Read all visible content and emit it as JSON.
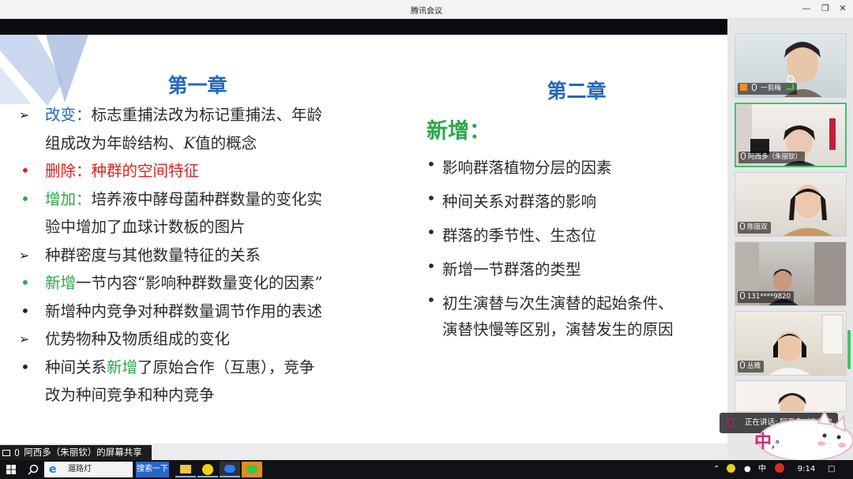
{
  "window": {
    "title": "腾讯会议",
    "minimize_icon": "minimize-icon",
    "restore_icon": "restore-icon",
    "close_icon": "close-icon"
  },
  "slide": {
    "chapter1_title": "第一章",
    "chapter2_title": "第二章",
    "left_items": [
      {
        "marker": "➢",
        "parts": [
          {
            "t": "改变：",
            "c": "blue"
          },
          {
            "t": "标志重捕法改为标记重捕法、年龄"
          }
        ]
      },
      {
        "marker": "",
        "parts": [
          {
            "t": "组成改为年龄结构、"
          },
          {
            "t": "K",
            "c": "k"
          },
          {
            "t": "值的概念"
          }
        ]
      },
      {
        "marker": "•",
        "marker_color": "red",
        "parts": [
          {
            "t": "删除：种群的空间特征",
            "c": "red"
          }
        ]
      },
      {
        "marker": "•",
        "marker_color": "green",
        "parts": [
          {
            "t": "增加：",
            "c": "green"
          },
          {
            "t": "培养液中酵母菌种群数量的变化实"
          }
        ]
      },
      {
        "marker": "",
        "parts": [
          {
            "t": "验中增加了血球计数板的图片"
          }
        ]
      },
      {
        "marker": "➢",
        "parts": [
          {
            "t": "种群密度与其他数量特征的关系"
          }
        ]
      },
      {
        "marker": "•",
        "marker_color": "green",
        "parts": [
          {
            "t": "新增",
            "c": "green"
          },
          {
            "t": "一节内容“影响种群数量变化的因素”"
          }
        ]
      },
      {
        "marker": "•",
        "parts": [
          {
            "t": "新增种内竞争对种群数量调节作用的表述"
          }
        ]
      },
      {
        "marker": "➢",
        "parts": [
          {
            "t": "优势物种及物质组成的变化"
          }
        ]
      },
      {
        "marker": "•",
        "parts": [
          {
            "t": "种间关系"
          },
          {
            "t": "新增",
            "c": "green"
          },
          {
            "t": "了原始合作（互惠），竞争"
          }
        ]
      },
      {
        "marker": "",
        "parts": [
          {
            "t": "改为种间竞争和种内竞争"
          }
        ]
      }
    ],
    "new_heading": "新增：",
    "right_items": [
      {
        "lines": [
          "影响群落植物分层的因素"
        ]
      },
      {
        "lines": [
          "种间关系对群落的影响"
        ]
      },
      {
        "lines": [
          "群落的季节性、生态位"
        ]
      },
      {
        "lines": [
          "新增一节群落的类型"
        ]
      },
      {
        "lines": [
          "初生演替与次生演替的起始条件、",
          "演替快慢等区别，演替发生的原因"
        ]
      }
    ]
  },
  "share_status": "阿西多（朱丽钦）的屏幕共享",
  "participants": [
    {
      "name": "一剪梅",
      "icon": "user-avatar-icon",
      "signal_icon": "signal-icon"
    },
    {
      "name": "阿西多（朱丽钦）",
      "active": true
    },
    {
      "name": "陈丽双"
    },
    {
      "name": "131****9820"
    },
    {
      "name": "丛雅"
    },
    {
      "name": ""
    }
  ],
  "speaking_status": "正在讲话: 阿西多（朱丽钦...",
  "ime_char": "中",
  "ime_mode": ",°",
  "taskbar": {
    "search_text": "遛路灯",
    "search_button": "搜索一下",
    "tray_lang": "中",
    "clock": "9:14"
  }
}
